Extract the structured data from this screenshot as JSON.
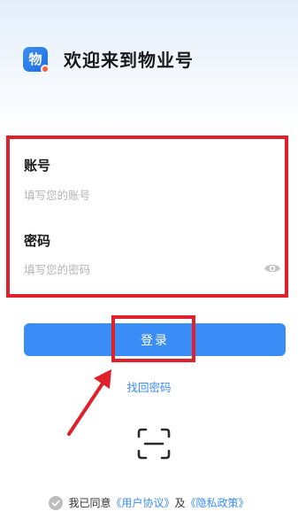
{
  "header": {
    "logo_char": "物",
    "title": "欢迎来到物业号"
  },
  "form": {
    "account_label": "账号",
    "account_placeholder": "填写您的账号",
    "account_value": "",
    "password_label": "密码",
    "password_placeholder": "填写您的密码",
    "password_value": ""
  },
  "login_button_label": "登录",
  "forgot_password_label": "找回密码",
  "agreement": {
    "prefix": "我已同意",
    "user_agreement": "《用户协议》",
    "conjunction": "及",
    "privacy_policy": "《隐私政策》",
    "checked": true
  },
  "icons": {
    "logo": "app-logo-icon",
    "password_toggle": "eye-icon",
    "scan": "scan-icon",
    "checkbox": "checkmark-circle-icon"
  },
  "colors": {
    "accent": "#3a8cf7",
    "highlight": "#e0202a"
  }
}
